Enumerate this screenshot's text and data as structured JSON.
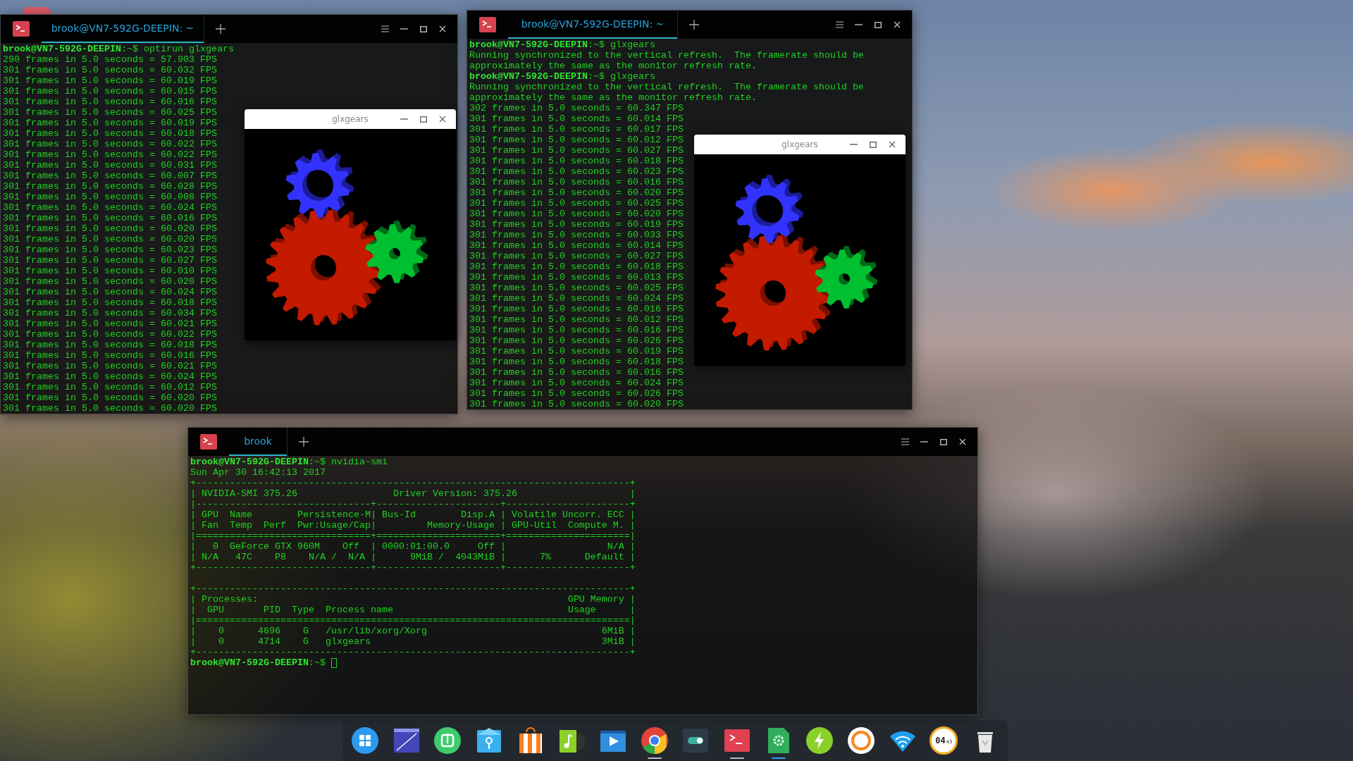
{
  "terminals": [
    {
      "tabs": [
        {
          "label": "brook@VN7-592G-DEEPIN: ~",
          "selected": true
        }
      ],
      "sections": [
        {
          "lines": [
            "**brook@VN7-592G-DEEPIN**:~$ optirun glxgears",
            "290 frames in 5.0 seconds = 57.903 FPS",
            "301 frames in 5.0 seconds = 60.032 FPS",
            "301 frames in 5.0 seconds = 60.019 FPS",
            "301 frames in 5.0 seconds = 60.015 FPS",
            "301 frames in 5.0 seconds = 60.016 FPS",
            "301 frames in 5.0 seconds = 60.025 FPS",
            "301 frames in 5.0 seconds = 60.019 FPS",
            "301 frames in 5.0 seconds = 60.018 FPS",
            "301 frames in 5.0 seconds = 60.022 FPS",
            "301 frames in 5.0 seconds = 60.022 FPS",
            "301 frames in 5.0 seconds = 60.031 FPS",
            "301 frames in 5.0 seconds = 60.007 FPS",
            "301 frames in 5.0 seconds = 60.028 FPS",
            "301 frames in 5.0 seconds = 60.008 FPS",
            "301 frames in 5.0 seconds = 60.024 FPS",
            "301 frames in 5.0 seconds = 60.016 FPS",
            "301 frames in 5.0 seconds = 60.020 FPS",
            "301 frames in 5.0 seconds = 60.020 FPS",
            "301 frames in 5.0 seconds = 60.023 FPS",
            "301 frames in 5.0 seconds = 60.027 FPS",
            "301 frames in 5.0 seconds = 60.010 FPS",
            "301 frames in 5.0 seconds = 60.020 FPS",
            "301 frames in 5.0 seconds = 60.024 FPS",
            "301 frames in 5.0 seconds = 60.018 FPS",
            "301 frames in 5.0 seconds = 60.034 FPS",
            "301 frames in 5.0 seconds = 60.021 FPS",
            "301 frames in 5.0 seconds = 60.022 FPS",
            "301 frames in 5.0 seconds = 60.018 FPS",
            "301 frames in 5.0 seconds = 60.016 FPS",
            "301 frames in 5.0 seconds = 60.021 FPS",
            "301 frames in 5.0 seconds = 60.024 FPS",
            "301 frames in 5.0 seconds = 60.012 FPS",
            "301 frames in 5.0 seconds = 60.020 FPS",
            "301 frames in 5.0 seconds = 60.020 FPS"
          ]
        }
      ]
    },
    {
      "tabs": [
        {
          "label": "brook@VN7-592G-DEEPIN: ~",
          "selected": true
        }
      ],
      "sections": [
        {
          "lines": [
            "**brook@VN7-592G-DEEPIN**:~$ glxgears",
            "Running synchronized to the vertical refresh.  The framerate should be",
            "approximately the same as the monitor refresh rate.",
            "**brook@VN7-592G-DEEPIN**:~$ glxgears",
            "Running synchronized to the vertical refresh.  The framerate should be",
            "approximately the same as the monitor refresh rate.",
            "302 frames in 5.0 seconds = 60.347 FPS",
            "301 frames in 5.0 seconds = 60.014 FPS",
            "301 frames in 5.0 seconds = 60.017 FPS",
            "301 frames in 5.0 seconds = 60.012 FPS",
            "301 frames in 5.0 seconds = 60.027 FPS",
            "301 frames in 5.0 seconds = 60.018 FPS",
            "301 frames in 5.0 seconds = 60.023 FPS",
            "301 frames in 5.0 seconds = 60.016 FPS",
            "301 frames in 5.0 seconds = 60.020 FPS",
            "301 frames in 5.0 seconds = 60.025 FPS",
            "301 frames in 5.0 seconds = 60.020 FPS",
            "301 frames in 5.0 seconds = 60.019 FPS",
            "301 frames in 5.0 seconds = 60.033 FPS",
            "301 frames in 5.0 seconds = 60.014 FPS",
            "301 frames in 5.0 seconds = 60.027 FPS",
            "301 frames in 5.0 seconds = 60.018 FPS",
            "301 frames in 5.0 seconds = 60.013 FPS",
            "301 frames in 5.0 seconds = 60.025 FPS",
            "301 frames in 5.0 seconds = 60.024 FPS",
            "301 frames in 5.0 seconds = 60.016 FPS",
            "301 frames in 5.0 seconds = 60.012 FPS",
            "301 frames in 5.0 seconds = 60.016 FPS",
            "301 frames in 5.0 seconds = 60.026 FPS",
            "301 frames in 5.0 seconds = 60.019 FPS",
            "301 frames in 5.0 seconds = 60.018 FPS",
            "301 frames in 5.0 seconds = 60.016 FPS",
            "301 frames in 5.0 seconds = 60.024 FPS",
            "301 frames in 5.0 seconds = 60.026 FPS",
            "301 frames in 5.0 seconds = 60.020 FPS"
          ]
        }
      ]
    },
    {
      "tabs": [
        {
          "label": "brook",
          "selected": true
        }
      ],
      "cursor": true,
      "sections": [
        {
          "lines": [
            "**brook@VN7-592G-DEEPIN**:~$ nvidia-smi",
            "Sun Apr 30 16:42:13 2017",
            "+-----------------------------------------------------------------------------+",
            "| NVIDIA-SMI 375.26                 Driver Version: 375.26                    |",
            "|-------------------------------+----------------------+----------------------+",
            "| GPU  Name        Persistence-M| Bus-Id        Disp.A | Volatile Uncorr. ECC |",
            "| Fan  Temp  Perf  Pwr:Usage/Cap|         Memory-Usage | GPU-Util  Compute M. |",
            "|===============================+======================+======================|",
            "|   0  GeForce GTX 960M    Off  | 0000:01:00.0     Off |                  N/A |",
            "| N/A   47C    P8    N/A /  N/A |      9MiB /  4043MiB |      7%      Default |",
            "+-------------------------------+----------------------+----------------------+"
          ]
        },
        {
          "lines": [
            "+-----------------------------------------------------------------------------+",
            "| Processes:                                                       GPU Memory |",
            "|  GPU       PID  Type  Process name                               Usage      |",
            "|=============================================================================|",
            "|    0      4696    G   /usr/lib/xorg/Xorg                               6MiB |",
            "|    0      4714    G   glxgears                                         3MiB |",
            "+-----------------------------------------------------------------------------+",
            "**brook@VN7-592G-DEEPIN**:~$ "
          ]
        }
      ]
    }
  ],
  "gear_windows": [
    {
      "title": "glxgears"
    },
    {
      "title": "glxgears"
    }
  ],
  "dock": {
    "items": [
      {
        "kind": "launcher",
        "running": false,
        "active": false
      },
      {
        "kind": "screenshot",
        "running": false,
        "active": false
      },
      {
        "kind": "share",
        "running": false,
        "active": false
      },
      {
        "kind": "files",
        "running": false,
        "active": false
      },
      {
        "kind": "store",
        "running": false,
        "active": false
      },
      {
        "kind": "music",
        "running": false,
        "active": false
      },
      {
        "kind": "video",
        "running": false,
        "active": false
      },
      {
        "kind": "browser",
        "running": true,
        "active": false
      },
      {
        "kind": "toggle",
        "running": false,
        "active": false
      },
      {
        "kind": "terminal",
        "running": true,
        "active": false
      },
      {
        "kind": "settings",
        "running": true,
        "active": true
      },
      {
        "kind": "power",
        "running": false,
        "active": false
      },
      {
        "kind": "lens",
        "running": false,
        "active": false
      },
      {
        "kind": "wifi",
        "running": false,
        "active": false
      },
      {
        "kind": "clock",
        "running": false,
        "active": false,
        "hour": "04",
        "minute": "43"
      },
      {
        "kind": "trash",
        "running": false,
        "active": false
      }
    ]
  }
}
